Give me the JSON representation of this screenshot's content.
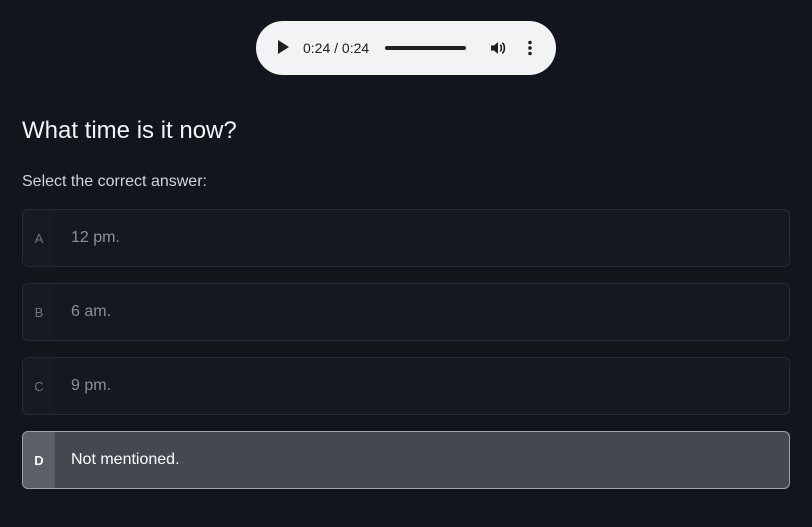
{
  "audio_player": {
    "time_display": "0:24 / 0:24",
    "progress": 1.0
  },
  "question": {
    "title": "What time is it now?",
    "instruction": "Select the correct answer:"
  },
  "options": [
    {
      "letter": "A",
      "text": "12 pm.",
      "selected": false
    },
    {
      "letter": "B",
      "text": "6 am.",
      "selected": false
    },
    {
      "letter": "C",
      "text": "9 pm.",
      "selected": false
    },
    {
      "letter": "D",
      "text": "Not mentioned.",
      "selected": true
    }
  ],
  "icons": {
    "play": "play-icon",
    "volume": "volume-icon",
    "more": "more-vertical-icon"
  },
  "colors": {
    "background": "#12151c",
    "selected_background": "#444850"
  }
}
